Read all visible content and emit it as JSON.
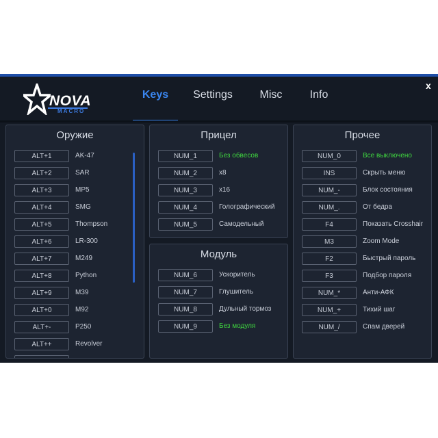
{
  "brand": {
    "word": "NOVA",
    "sub": "MACRO"
  },
  "tabs": [
    {
      "label": "Keys",
      "active": true
    },
    {
      "label": "Settings",
      "active": false
    },
    {
      "label": "Misc",
      "active": false
    },
    {
      "label": "Info",
      "active": false
    }
  ],
  "close_label": "x",
  "colors": {
    "accent": "#3a86f0",
    "highlight": "#3fd43f",
    "panel": "#1d2431",
    "background": "#141a24"
  },
  "weapons": {
    "title": "Оружие",
    "rows": [
      {
        "key": "ALT+1",
        "label": "AK-47"
      },
      {
        "key": "ALT+2",
        "label": "SAR"
      },
      {
        "key": "ALT+3",
        "label": "MP5"
      },
      {
        "key": "ALT+4",
        "label": "SMG"
      },
      {
        "key": "ALT+5",
        "label": "Thompson"
      },
      {
        "key": "ALT+6",
        "label": "LR-300"
      },
      {
        "key": "ALT+7",
        "label": "M249"
      },
      {
        "key": "ALT+8",
        "label": "Python"
      },
      {
        "key": "ALT+9",
        "label": "M39"
      },
      {
        "key": "ALT+0",
        "label": "M92"
      },
      {
        "key": "ALT+-",
        "label": "P250"
      },
      {
        "key": "ALT++",
        "label": "Revolver"
      },
      {
        "key": "",
        "label": ""
      }
    ]
  },
  "sight": {
    "title": "Прицел",
    "rows": [
      {
        "key": "NUM_1",
        "label": "Без обвесов",
        "highlight": true
      },
      {
        "key": "NUM_2",
        "label": "x8"
      },
      {
        "key": "NUM_3",
        "label": "x16"
      },
      {
        "key": "NUM_4",
        "label": "Голографический"
      },
      {
        "key": "NUM_5",
        "label": "Самодельный"
      }
    ]
  },
  "module": {
    "title": "Модуль",
    "rows": [
      {
        "key": "NUM_6",
        "label": "Ускоритель"
      },
      {
        "key": "NUM_7",
        "label": "Глушитель"
      },
      {
        "key": "NUM_8",
        "label": "Дульный тормоз"
      },
      {
        "key": "NUM_9",
        "label": "Без модуля",
        "highlight": true
      }
    ]
  },
  "other": {
    "title": "Прочее",
    "rows": [
      {
        "key": "NUM_0",
        "label": "Все выключено",
        "highlight": true
      },
      {
        "key": "INS",
        "label": "Скрыть меню"
      },
      {
        "key": "NUM_-",
        "label": "Блок состояния"
      },
      {
        "key": "NUM_.",
        "label": "От бедра"
      },
      {
        "key": "F4",
        "label": "Показать Crosshair"
      },
      {
        "key": "M3",
        "label": "Zoom Mode"
      },
      {
        "key": "F2",
        "label": "Быстрый пароль"
      },
      {
        "key": "F3",
        "label": "Подбор пароля"
      },
      {
        "key": "NUM_*",
        "label": "Анти-АФК"
      },
      {
        "key": "NUM_+",
        "label": "Тихий шаг"
      },
      {
        "key": "NUM_/",
        "label": "Спам дверей"
      }
    ]
  }
}
